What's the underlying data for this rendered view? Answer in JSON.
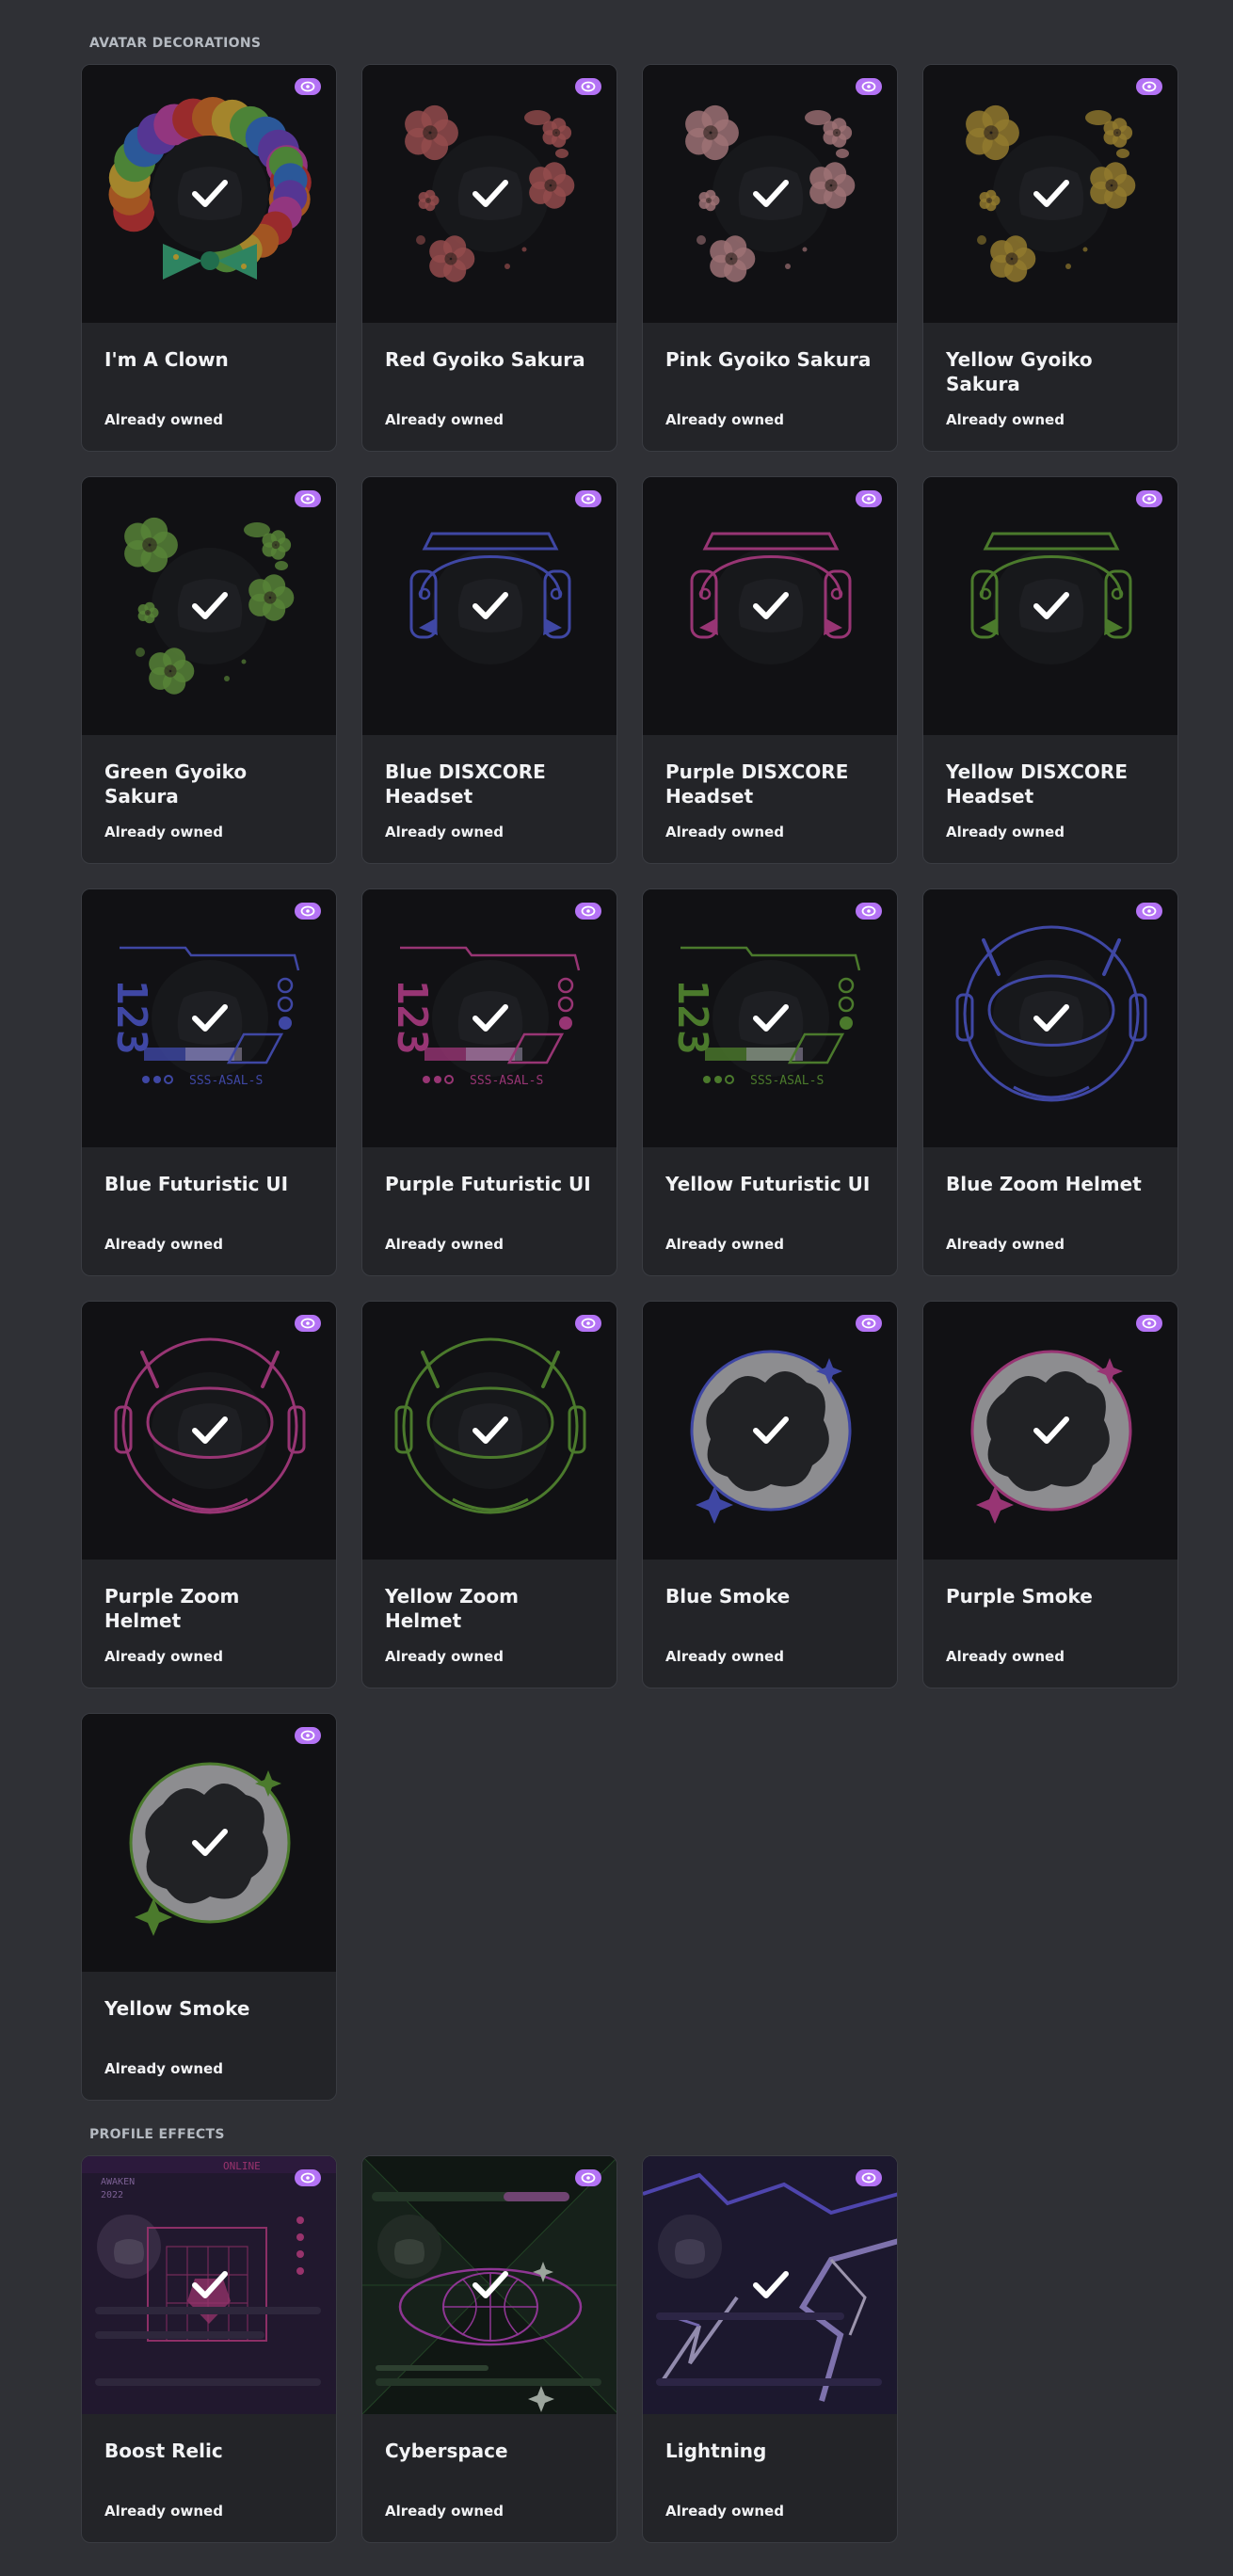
{
  "sections": {
    "avatar_decorations": "AVATAR DECORATIONS",
    "profile_effects": "PROFILE EFFECTS"
  },
  "status_label": "Already owned",
  "colors": {
    "background": "#2f3035",
    "card": "#232428",
    "preview": "#111214",
    "nitro_badge": "#b473f5",
    "blue_accent": "#5865f2",
    "purple_accent": "#e049a8",
    "yellow_accent": "#6bb33a"
  },
  "avatar_decorations": [
    {
      "name": "I'm A Clown",
      "status": "Already owned",
      "art": "clown"
    },
    {
      "name": "Red Gyoiko Sakura",
      "status": "Already owned",
      "art": "sakura",
      "color": "#d96b6b"
    },
    {
      "name": "Pink Gyoiko Sakura",
      "status": "Already owned",
      "art": "sakura",
      "color": "#e8a4a8"
    },
    {
      "name": "Yellow Gyoiko Sakura",
      "status": "Already owned",
      "art": "sakura",
      "color": "#d6b23c"
    },
    {
      "name": "Green Gyoiko Sakura",
      "status": "Already owned",
      "art": "sakura",
      "color": "#7cbf4a"
    },
    {
      "name": "Blue DISXCORE Headset",
      "status": "Already owned",
      "art": "headset",
      "color": "#5865f2"
    },
    {
      "name": "Purple DISXCORE Headset",
      "status": "Already owned",
      "art": "headset",
      "color": "#e049a8"
    },
    {
      "name": "Yellow DISXCORE Headset",
      "status": "Already owned",
      "art": "headset",
      "color": "#6bb33a"
    },
    {
      "name": "Blue Futuristic UI",
      "status": "Already owned",
      "art": "futuristic",
      "color": "#5865f2"
    },
    {
      "name": "Purple Futuristic UI",
      "status": "Already owned",
      "art": "futuristic",
      "color": "#e049a8"
    },
    {
      "name": "Yellow Futuristic UI",
      "status": "Already owned",
      "art": "futuristic",
      "color": "#6bb33a"
    },
    {
      "name": "Blue Zoom Helmet",
      "status": "Already owned",
      "art": "helmet",
      "color": "#5865f2"
    },
    {
      "name": "Purple Zoom Helmet",
      "status": "Already owned",
      "art": "helmet",
      "color": "#e049a8"
    },
    {
      "name": "Yellow Zoom Helmet",
      "status": "Already owned",
      "art": "helmet",
      "color": "#6bb33a"
    },
    {
      "name": "Blue Smoke",
      "status": "Already owned",
      "art": "smoke",
      "color": "#5865f2"
    },
    {
      "name": "Purple Smoke",
      "status": "Already owned",
      "art": "smoke",
      "color": "#e049a8"
    },
    {
      "name": "Yellow Smoke",
      "status": "Already owned",
      "art": "smoke",
      "color": "#6bb33a"
    }
  ],
  "profile_effects": [
    {
      "name": "Boost Relic",
      "status": "Already owned",
      "art": "relic",
      "color": "#e0459b"
    },
    {
      "name": "Cyberspace",
      "status": "Already owned",
      "art": "cyber",
      "color": "#4ec24e"
    },
    {
      "name": "Lightning",
      "status": "Already owned",
      "art": "lightning",
      "color": "#8a6cff"
    }
  ]
}
